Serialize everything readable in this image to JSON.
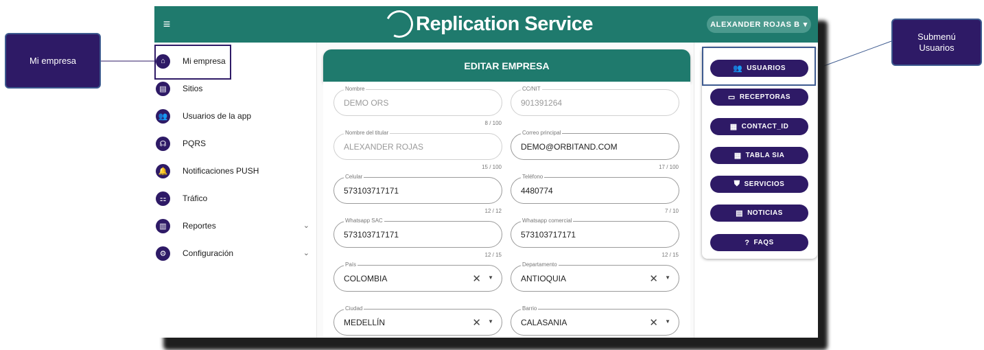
{
  "callouts": {
    "left": "Mi empresa",
    "right_line1": "Submenú",
    "right_line2": "Usuarios"
  },
  "header": {
    "menu_icon": "hamburger-icon",
    "title": "Replication Service",
    "user_label": "ALEXANDER ROJAS B",
    "user_caret": "▾"
  },
  "sidebar": {
    "items": [
      {
        "label": "Mi empresa",
        "icon": "home-icon",
        "glyph": "⌂"
      },
      {
        "label": "Sitios",
        "icon": "store-icon",
        "glyph": "▤"
      },
      {
        "label": "Usuarios de la app",
        "icon": "users-icon",
        "glyph": "👥"
      },
      {
        "label": "PQRS",
        "icon": "headset-icon",
        "glyph": "☊"
      },
      {
        "label": "Notificaciones PUSH",
        "icon": "bell-icon",
        "glyph": "🔔"
      },
      {
        "label": "Tráfico",
        "icon": "traffic-light-icon",
        "glyph": "⚏"
      },
      {
        "label": "Reportes",
        "icon": "chart-icon",
        "glyph": "▥",
        "chevron": "⌄"
      },
      {
        "label": "Configuración",
        "icon": "gear-icon",
        "glyph": "⚙",
        "chevron": "⌄"
      }
    ]
  },
  "form": {
    "title": "EDITAR EMPRESA",
    "fields": {
      "nombre": {
        "label": "Nombre",
        "value": "DEMO ORS",
        "count": "8 / 100"
      },
      "ccnit": {
        "label": "CC/NIT",
        "value": "901391264"
      },
      "titular": {
        "label": "Nombre del titular",
        "value": "ALEXANDER ROJAS",
        "count": "15 / 100"
      },
      "correo": {
        "label": "Correo principal",
        "value": "DEMO@ORBITAND.COM",
        "count": "17 / 100"
      },
      "celular": {
        "label": "Celular",
        "value": "573103717171",
        "count": "12 / 12"
      },
      "telefono": {
        "label": "Teléfono",
        "value": "4480774",
        "count": "7 / 10"
      },
      "wsac": {
        "label": "Whatsapp SAC",
        "value": "573103717171",
        "count": "12 / 15"
      },
      "wcom": {
        "label": "Whatsapp comercial",
        "value": "573103717171",
        "count": "12 / 15"
      },
      "pais": {
        "label": "País",
        "value": "COLOMBIA"
      },
      "depto": {
        "label": "Departamento",
        "value": "ANTIOQUIA"
      },
      "ciudad": {
        "label": "Ciudad",
        "value": "MEDELLÍN"
      },
      "barrio": {
        "label": "Barrio",
        "value": "CALASANIA"
      }
    },
    "clear_glyph": "✕",
    "arrow_glyph": "▼"
  },
  "submenu": {
    "buttons": [
      {
        "label": "USUARIOS",
        "icon": "users-icon",
        "glyph": "👥"
      },
      {
        "label": "RECEPTORAS",
        "icon": "monitor-icon",
        "glyph": "▭"
      },
      {
        "label": "CONTACT_ID",
        "icon": "table-icon",
        "glyph": "▦"
      },
      {
        "label": "TABLA SIA",
        "icon": "table-icon",
        "glyph": "▦"
      },
      {
        "label": "SERVICIOS",
        "icon": "shield-icon",
        "glyph": "⛊"
      },
      {
        "label": "NOTICIAS",
        "icon": "article-icon",
        "glyph": "▤"
      },
      {
        "label": "FAQS",
        "icon": "help-icon",
        "glyph": "?"
      }
    ]
  },
  "colors": {
    "header_teal": "#1f7a6d",
    "accent_purple": "#2e1a66"
  }
}
